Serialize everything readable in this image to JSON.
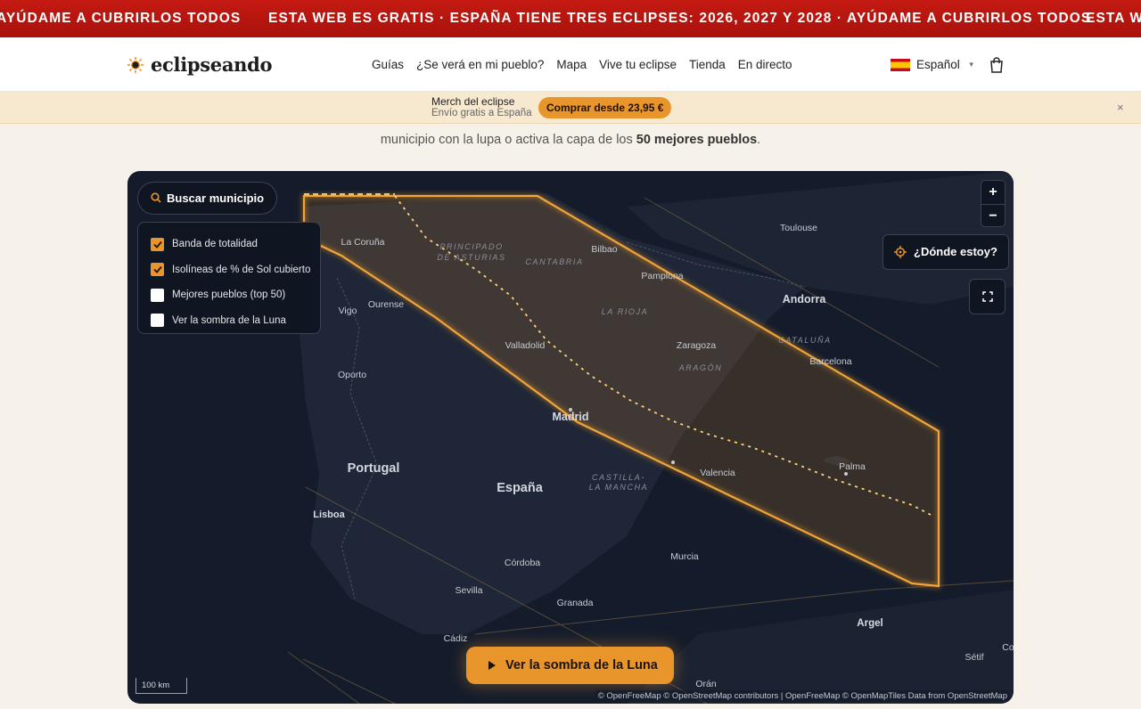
{
  "ticker": {
    "text_a": "AYÚDAME A CUBRIRLOS TODOS",
    "text_b": "ESTA WEB ES GRATIS · ESPAÑA TIENE TRES ECLIPSES: 2026, 2027 Y 2028 · AYÚDAME A CUBRIRLOS TODOS",
    "text_c": "ESTA W"
  },
  "nav": {
    "logo": "eclipseando",
    "items": [
      "Guías",
      "¿Se verá en mi pueblo?",
      "Mapa",
      "Vive tu eclipse",
      "Tienda",
      "En directo"
    ],
    "language": "Español"
  },
  "promo": {
    "title": "Merch del eclipse",
    "subtitle": "Envío gratis a España",
    "button": "Comprar desde 23,95 €",
    "close": "×"
  },
  "intro": {
    "before": "municipio con la lupa o activa la capa de los ",
    "bold": "50 mejores pueblos",
    "after": "."
  },
  "map": {
    "search_label": "Buscar municipio",
    "layers": [
      {
        "label": "Banda de totalidad",
        "checked": true
      },
      {
        "label": "Isolíneas de % de Sol cubierto",
        "checked": true
      },
      {
        "label": "Mejores pueblos (top 50)",
        "checked": false
      },
      {
        "label": "Ver la sombra de la Luna",
        "checked": false
      }
    ],
    "zoom_in": "+",
    "zoom_out": "−",
    "locate_label": "¿Dónde estoy?",
    "shadow_button": "Ver la sombra de la Luna",
    "scale": "100 km",
    "attribution": "© OpenFreeMap © OpenStreetMap contributors | OpenFreeMap © OpenMapTiles Data from OpenStreetMap",
    "labels": {
      "toulouse": "Toulouse",
      "andorra": "Andorra",
      "cataluna": "CATALUÑA",
      "barcelona": "Barcelona",
      "coruna": "La Coruña",
      "asturias1": "PRINCIPADO",
      "asturias2": "DE ASTURIAS",
      "cantabria": "CANTABRIA",
      "bilbao": "Bilbao",
      "pamplona": "Pamplona",
      "larioja": "LA RIOJA",
      "vigo": "Vigo",
      "ourense": "Ourense",
      "valladolid": "Valladolid",
      "zaragoza": "Zaragoza",
      "aragon": "ARAGÓN",
      "oporto": "Oporto",
      "madrid": "Madrid",
      "portugal": "Portugal",
      "espana": "España",
      "castilla1": "CASTILLA-",
      "castilla2": "LA MANCHA",
      "valencia": "Valencia",
      "palma": "Palma",
      "lisboa": "Lisboa",
      "cordoba": "Córdoba",
      "murcia": "Murcia",
      "sevilla": "Sevilla",
      "granada": "Granada",
      "argel": "Argel",
      "cadiz": "Cádiz",
      "setif": "Sétif",
      "oran": "Orán",
      "co": "Co"
    }
  },
  "colors": {
    "accent": "#e8952b",
    "ticker": "#b8160f",
    "map_bg": "#141c2b"
  }
}
